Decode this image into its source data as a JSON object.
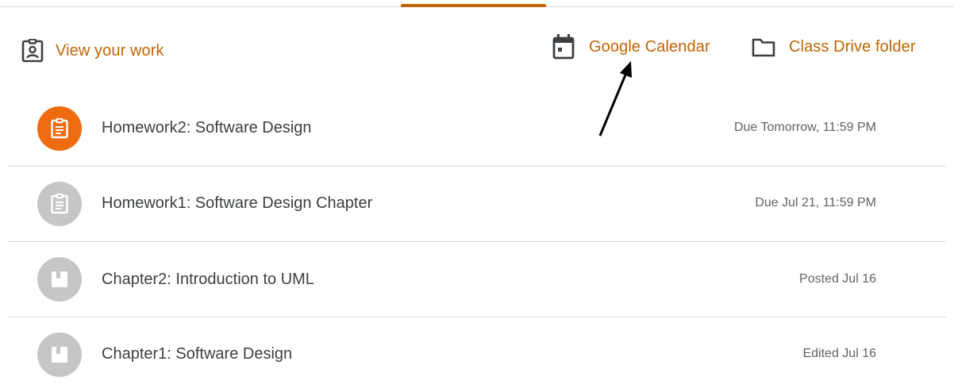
{
  "toolbar": {
    "view_work": {
      "label": "View your work",
      "icon": "assignment-ind-icon"
    },
    "calendar": {
      "label": "Google Calendar",
      "icon": "calendar-icon"
    },
    "drive": {
      "label": "Class Drive folder",
      "icon": "folder-icon"
    }
  },
  "colors": {
    "accent": "#c26401",
    "active_circle": "#ee6c0f",
    "inactive_circle": "#c6c6c6",
    "divider": "#dadce0"
  },
  "items": [
    {
      "title": "Homework2: Software Design",
      "meta": "Due Tomorrow, 11:59 PM",
      "type": "assignment",
      "state": "active"
    },
    {
      "title": "Homework1: Software Design Chapter",
      "meta": "Due Jul 21, 11:59 PM",
      "type": "assignment",
      "state": "inactive"
    },
    {
      "title": "Chapter2: Introduction to UML",
      "meta": "Posted Jul 16",
      "type": "material",
      "state": "inactive"
    },
    {
      "title": "Chapter1: Software Design",
      "meta": "Edited Jul 16",
      "type": "material",
      "state": "inactive"
    }
  ]
}
